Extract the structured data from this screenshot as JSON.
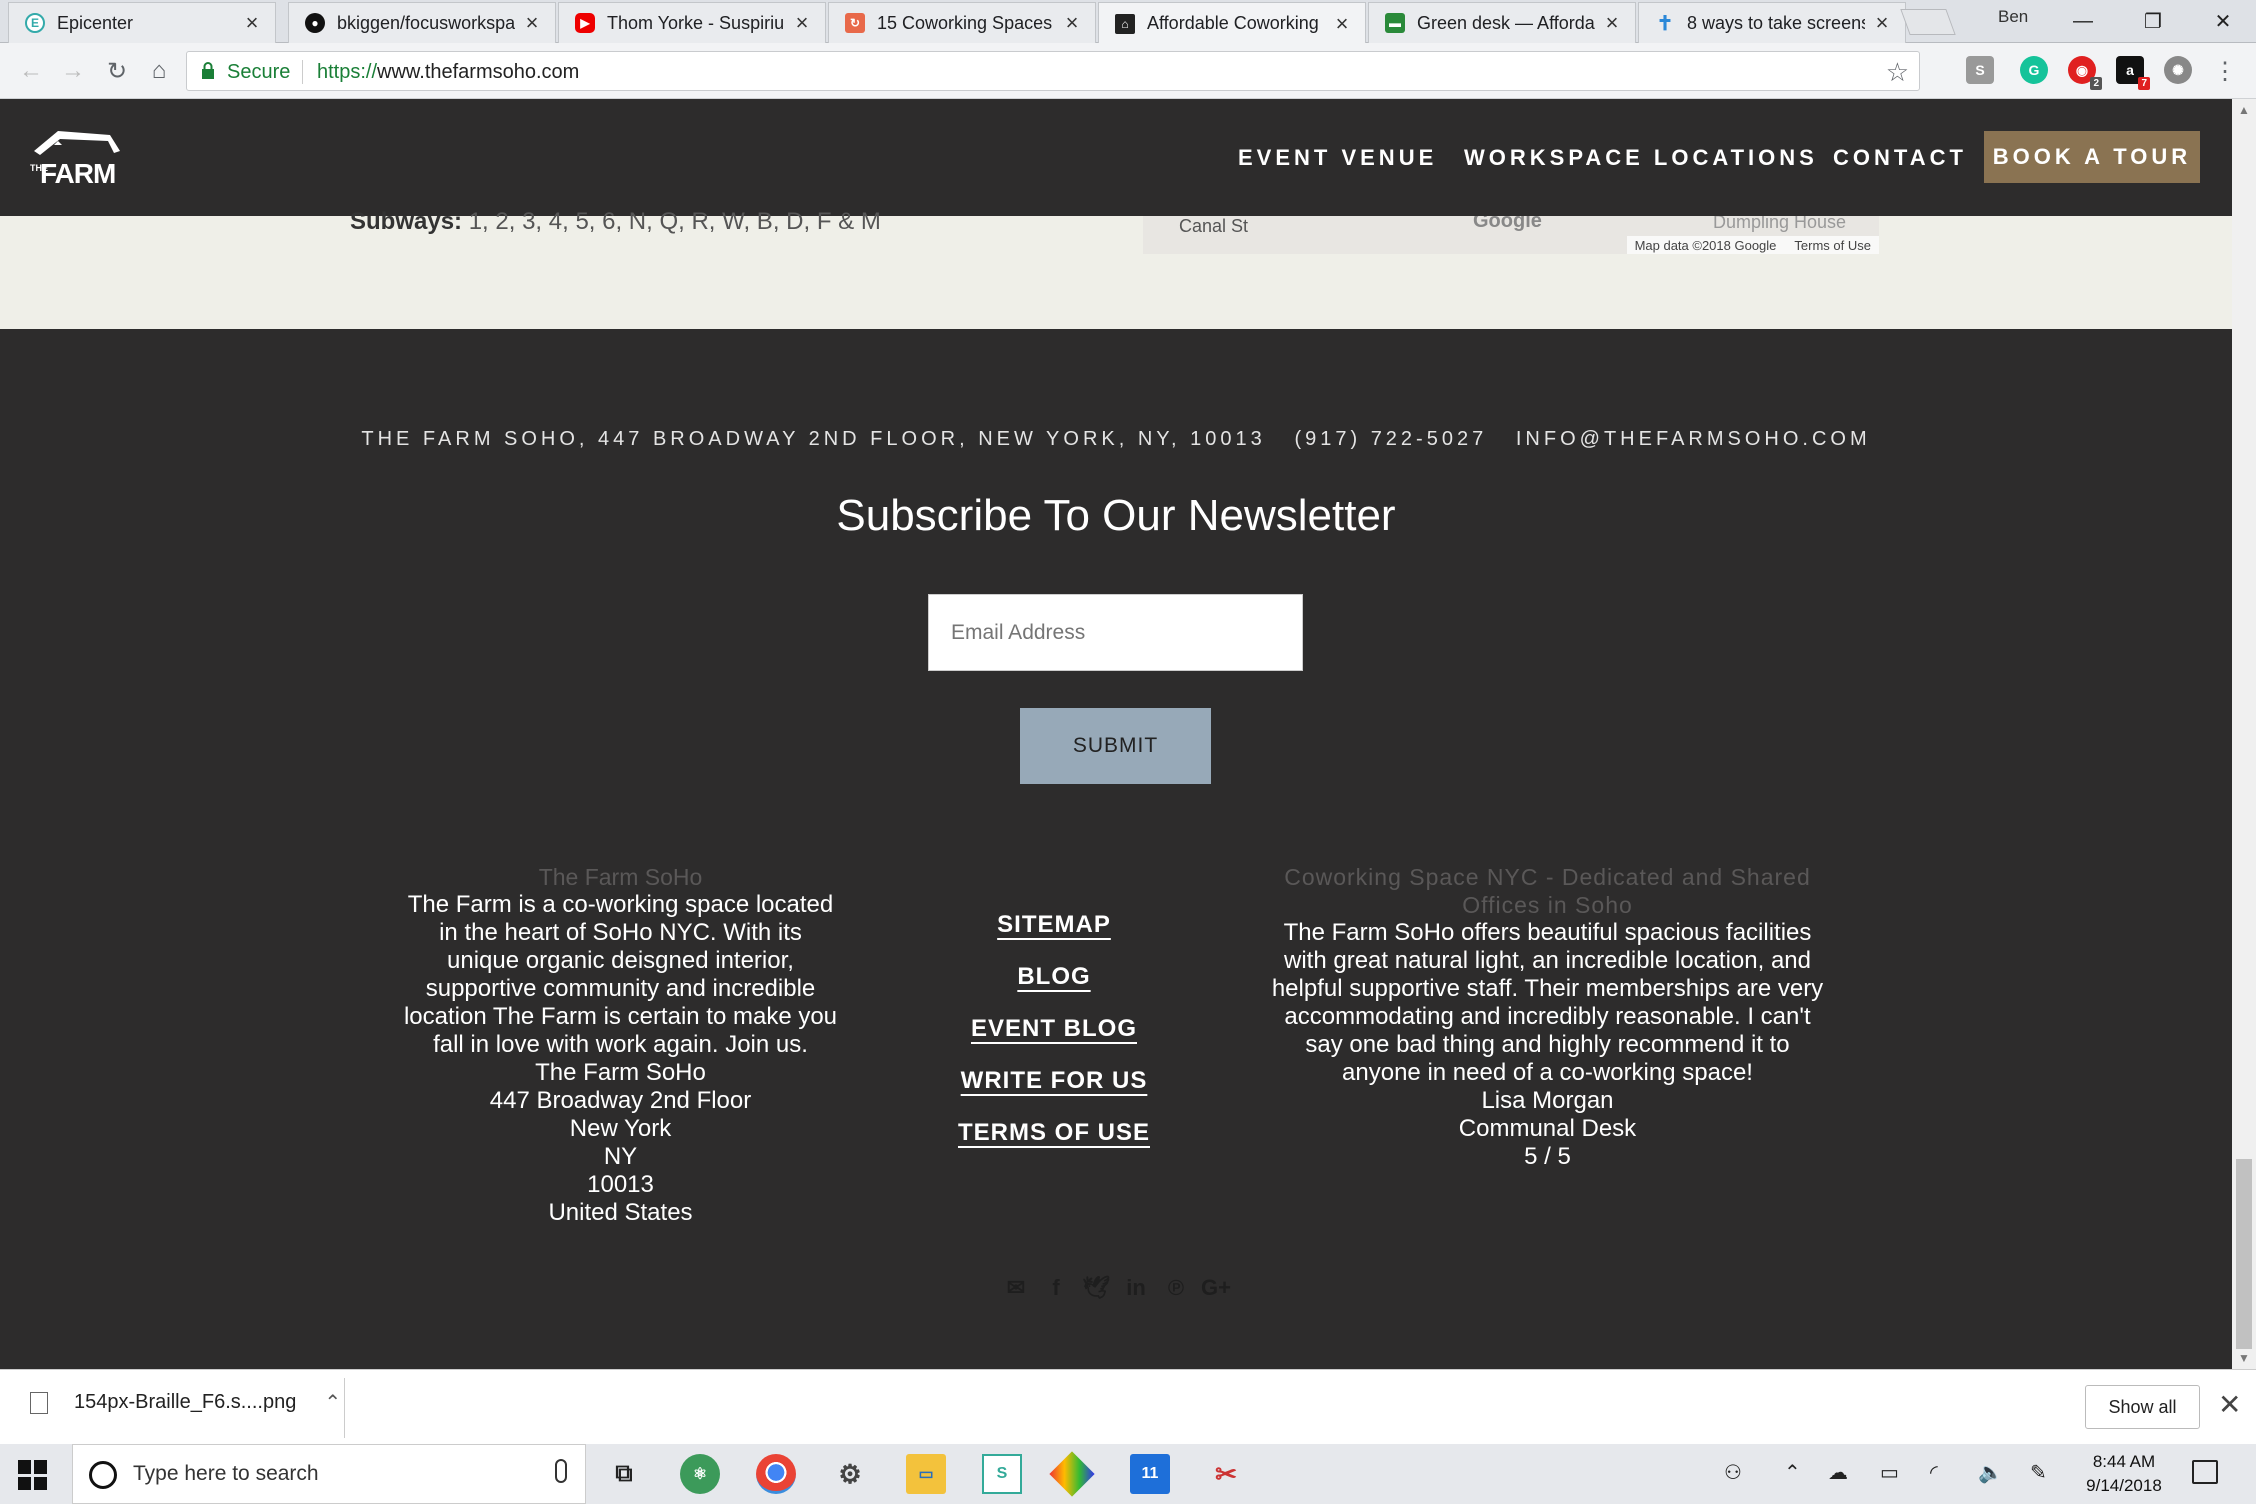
{
  "browser": {
    "tabs": [
      {
        "title": "Epicenter",
        "favicon": "E",
        "color": "#3c9",
        "active": false
      },
      {
        "title": "bkiggen/focusworkspa",
        "favicon": "gh",
        "color": "#111",
        "active": false
      },
      {
        "title": "Thom Yorke - Suspiriu",
        "favicon": "yt",
        "color": "#e00",
        "active": false
      },
      {
        "title": "15 Coworking Spaces i",
        "favicon": "15",
        "color": "#e8694a",
        "active": false
      },
      {
        "title": "Affordable Coworking",
        "favicon": "farm",
        "color": "#222",
        "active": true
      },
      {
        "title": "Green desk — Afforda",
        "favicon": "gd",
        "color": "#2a8a3a",
        "active": false
      },
      {
        "title": "8 ways to take screens",
        "favicon": "t",
        "color": "#2b88d8",
        "active": false
      }
    ],
    "user": "Ben",
    "secure_label": "Secure",
    "url_proto": "https://",
    "url_rest": "www.thefarmsoho.com",
    "extensions": [
      {
        "name": "s-extension-icon",
        "label": "S",
        "color": "#999"
      },
      {
        "name": "grammarly-icon",
        "label": "G",
        "color": "#15c39a"
      },
      {
        "name": "adblock-icon",
        "label": "◉",
        "color": "#e02020",
        "badge": "2"
      },
      {
        "name": "amazon-icon",
        "label": "a",
        "color": "#111",
        "badge": "7"
      },
      {
        "name": "settings-extension-icon",
        "label": "✺",
        "color": "#888"
      }
    ]
  },
  "site": {
    "nav": {
      "event_venue": "EVENT VENUE",
      "workspace_locations": "WORKSPACE LOCATIONS",
      "contact": "CONTACT",
      "book_tour": "BOOK A TOUR"
    },
    "logo_text": "THE FARM",
    "subways_label": "Subways:",
    "subways_lines": "1, 2, 3, 4, 5, 6, N, Q, R, W, B, D, F & M",
    "map": {
      "street": "Canal St",
      "google": "Google",
      "place": "Dumpling House",
      "map_data": "Map data ©2018 Google",
      "terms": "Terms of Use"
    },
    "footer": {
      "address_line": "THE FARM SOHO, 447 BROADWAY 2ND FLOOR, NEW YORK, NY, 10013   (917) 722-5027   INFO@THEFARMSOHO.COM",
      "newsletter_title": "Subscribe To Our Newsletter",
      "email_placeholder": "Email Address",
      "submit_label": "SUBMIT",
      "left": {
        "heading": "The Farm SoHo",
        "lines": [
          "The Farm is a co-working space located",
          "in the heart of SoHo NYC. With its",
          "unique organic deisgned interior,",
          "supportive community and incredible",
          "location The Farm is certain to make you",
          "fall in love with work again. Join us.",
          "The Farm SoHo",
          "447 Broadway 2nd Floor",
          "New York",
          "NY",
          "10013",
          "United States"
        ]
      },
      "links": [
        "SITEMAP",
        "BLOG",
        "EVENT BLOG",
        "WRITE FOR US",
        "TERMS OF USE"
      ],
      "right": {
        "heading_1": "Coworking Space NYC - Dedicated and Shared",
        "heading_2": "Offices in Soho",
        "lines": [
          "The Farm SoHo offers beautiful spacious facilities",
          "with great natural light, an incredible location, and",
          "helpful supportive staff. Their memberships are very",
          "accommodating and incredibly reasonable. I can't",
          "say one bad thing and highly recommend it to",
          "anyone in need of a co-working space!",
          "Lisa Morgan",
          "Communal Desk",
          "5 / 5"
        ]
      },
      "social_icons": [
        "email-icon",
        "facebook-icon",
        "twitter-icon",
        "linkedin-icon",
        "pinterest-icon",
        "google-plus-icon"
      ]
    }
  },
  "downloads": {
    "file_name": "154px-Braille_F6.s....png",
    "show_all": "Show all"
  },
  "taskbar": {
    "search_placeholder": "Type here to search",
    "time": "8:44 AM",
    "date": "9/14/2018"
  }
}
